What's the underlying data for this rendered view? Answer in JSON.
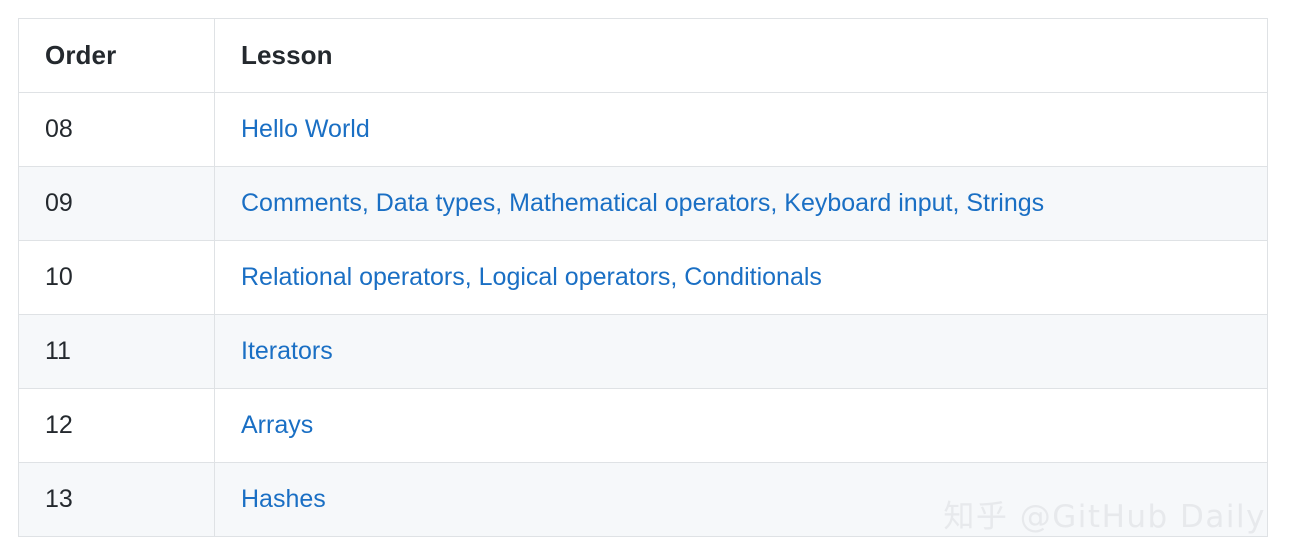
{
  "table": {
    "columns": [
      {
        "key": "order",
        "label": "Order"
      },
      {
        "key": "lesson",
        "label": "Lesson"
      }
    ],
    "rows": [
      {
        "order": "08",
        "lesson": "Hello World"
      },
      {
        "order": "09",
        "lesson": "Comments, Data types, Mathematical operators, Keyboard input, Strings"
      },
      {
        "order": "10",
        "lesson": "Relational operators, Logical operators, Conditionals"
      },
      {
        "order": "11",
        "lesson": "Iterators"
      },
      {
        "order": "12",
        "lesson": "Arrays"
      },
      {
        "order": "13",
        "lesson": "Hashes"
      }
    ]
  },
  "watermark": {
    "text": "知乎 @GitHub Daily"
  },
  "colors": {
    "link": "#1a6fc4",
    "text": "#24292e",
    "border": "#dfe2e5",
    "stripe": "#f6f8fa",
    "background": "#ffffff",
    "watermark": "#e7e9ec"
  }
}
